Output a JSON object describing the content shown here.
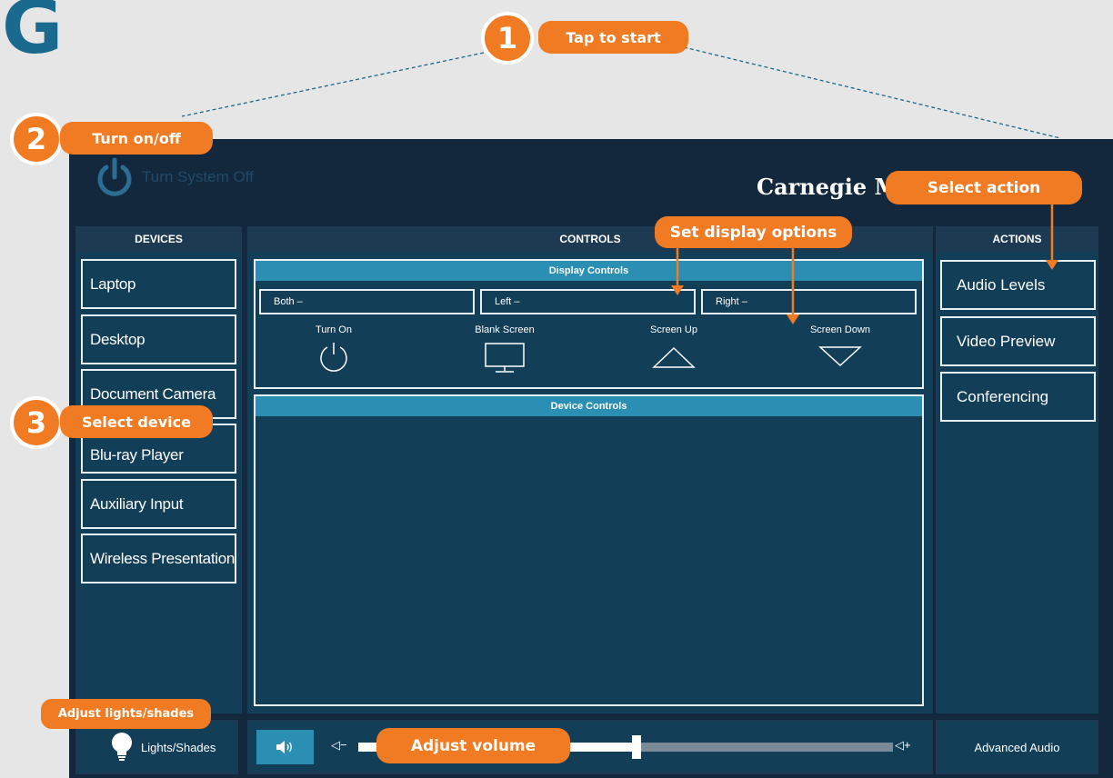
{
  "logo": {
    "letter": "G"
  },
  "header": {
    "power_label": "Turn System Off",
    "brand": "Carnegie M"
  },
  "devices": {
    "title": "DEVICES",
    "items": [
      "Laptop",
      "Desktop",
      "Document Camera",
      "Blu-ray Player",
      "Auxiliary Input",
      "Wireless Presentation"
    ]
  },
  "controls": {
    "title": "CONTROLS",
    "display_controls": {
      "title": "Display Controls",
      "selectors": [
        "Both –",
        "Left –",
        "Right –"
      ],
      "buttons": [
        {
          "label": "Turn On",
          "icon": "power-circle-icon"
        },
        {
          "label": "Blank Screen",
          "icon": "monitor-icon"
        },
        {
          "label": "Screen Up",
          "icon": "triangle-up-icon"
        },
        {
          "label": "Screen Down",
          "icon": "triangle-down-icon"
        }
      ]
    },
    "device_controls": {
      "title": "Device Controls"
    }
  },
  "actions": {
    "title": "ACTIONS",
    "items": [
      "Audio Levels",
      "Video Preview",
      "Conferencing"
    ]
  },
  "bottom_bar": {
    "lights_label": "Lights/Shades",
    "lights_icon": "lightbulb-icon",
    "mute_icon": "speaker-icon",
    "volume_minus": "◁−",
    "volume_plus": "◁+",
    "volume_level": 0.52,
    "advanced_audio": "Advanced Audio"
  },
  "callouts": {
    "step1": {
      "number": "1",
      "label": "Tap to start"
    },
    "step2": {
      "number": "2",
      "label": "Turn on/off"
    },
    "step3": {
      "number": "3",
      "label": "Select device"
    },
    "select_action": "Select action",
    "set_display": "Set display options",
    "adjust_lights": "Adjust lights/shades",
    "adjust_volume": "Adjust volume"
  },
  "colors": {
    "accent_orange": "#f07b22",
    "panel_dark": "#14283d",
    "column_blue": "#123e58",
    "header_strip": "#2a8fb3"
  }
}
